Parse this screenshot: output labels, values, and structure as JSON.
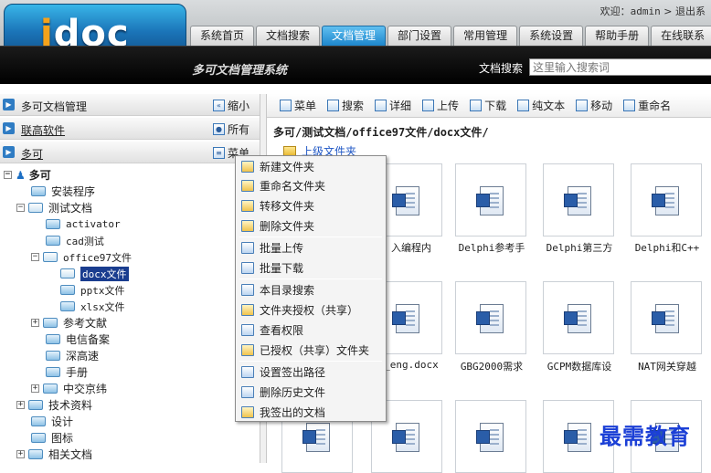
{
  "header": {
    "logo": "idoc",
    "welcome_prefix": "欢迎：",
    "user": "admin",
    "logout": "退出系",
    "nav": [
      "系统首页",
      "文档搜索",
      "文档管理",
      "部门设置",
      "常用管理",
      "系统设置",
      "帮助手册",
      "在线联系"
    ],
    "active_nav": "文档管理",
    "app_name": "多可文档管理系统",
    "search_label": "文档搜索",
    "search_placeholder": "这里输入搜索词"
  },
  "left": {
    "sections": [
      {
        "title": "多可文档管理",
        "btn": "缩小"
      },
      {
        "title": "联高软件",
        "btn": "所有"
      },
      {
        "title": "多可",
        "btn": "菜单"
      }
    ],
    "tree": [
      {
        "label": "多可",
        "pm": "−"
      },
      {
        "label": "安装程序"
      },
      {
        "label": "测试文档",
        "pm": "−"
      },
      {
        "label": "activator"
      },
      {
        "label": "cad测试"
      },
      {
        "label": "office97文件",
        "pm": "−"
      },
      {
        "label": "docx文件"
      },
      {
        "label": "pptx文件"
      },
      {
        "label": "xlsx文件"
      },
      {
        "label": "参考文献",
        "pm": "+"
      },
      {
        "label": "电信备案"
      },
      {
        "label": "深高速"
      },
      {
        "label": "手册"
      },
      {
        "label": "中交京纬",
        "pm": "+"
      },
      {
        "label": "技术资料",
        "pm": "+"
      },
      {
        "label": "设计"
      },
      {
        "label": "图标"
      },
      {
        "label": "相关文档",
        "pm": "+"
      }
    ]
  },
  "toolbar": [
    "菜单",
    "搜索",
    "详细",
    "上传",
    "下载",
    "纯文本",
    "移动",
    "重命名"
  ],
  "path": "多可/测试文档/office97文件/docx文件/",
  "up_label": "上级文件夹",
  "files": [
    [
      "",
      "入编程内",
      "Delphi参考手",
      "Delphi第三方",
      "Delphi和C++"
    ],
    [
      "",
      "_eng.docx",
      "GBG2000需求",
      "GCPM数据库设",
      "NAT网关穿越"
    ],
    [
      "",
      "",
      "",
      "",
      ""
    ]
  ],
  "context_menu": [
    [
      "新建文件夹",
      "重命名文件夹",
      "转移文件夹",
      "删除文件夹"
    ],
    [
      "批量上传",
      "批量下载"
    ],
    [
      "本目录搜索",
      "文件夹授权（共享）",
      "查看权限",
      "已授权（共享）文件夹"
    ],
    [
      "设置签出路径",
      "删除历史文件",
      "我签出的文档"
    ]
  ],
  "watermark": "最需教育"
}
